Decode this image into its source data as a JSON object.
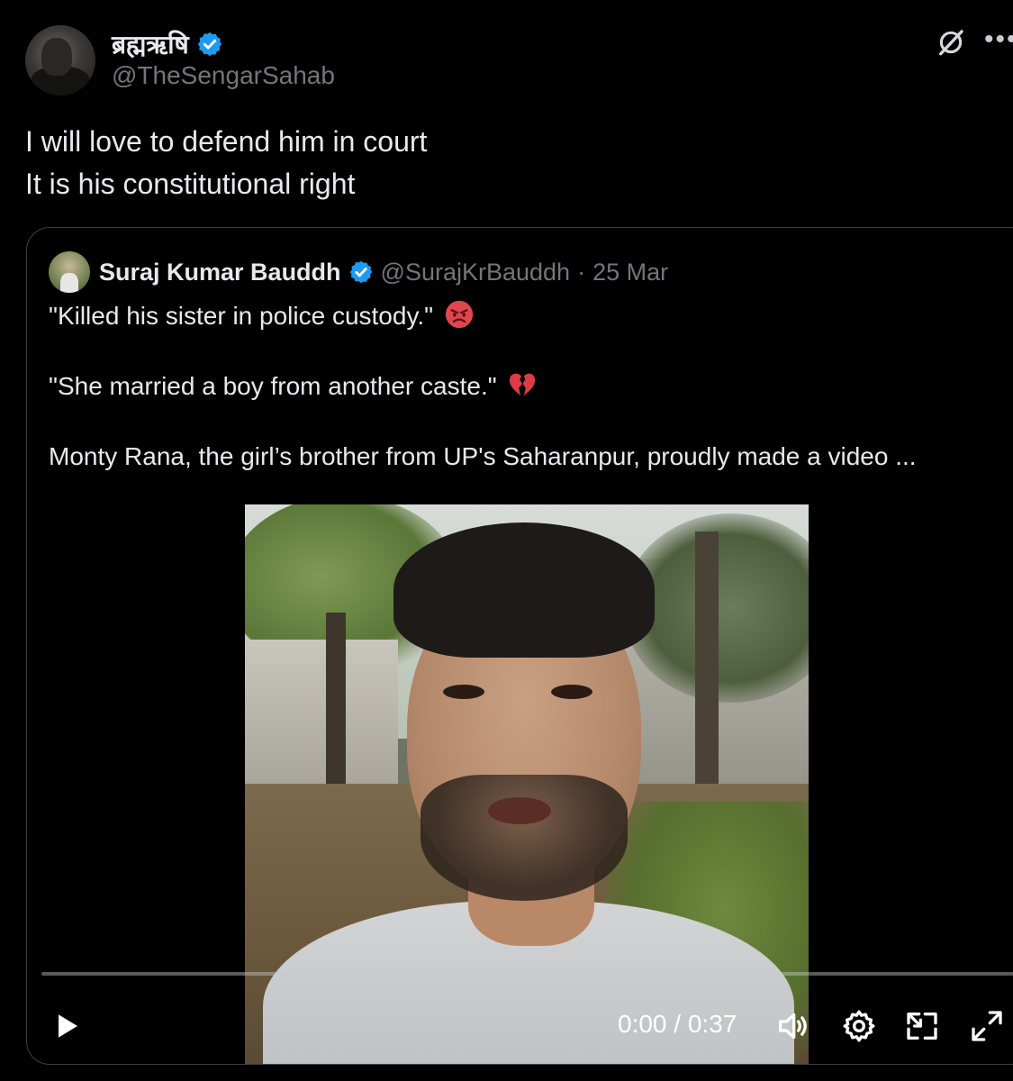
{
  "author": {
    "display_name": "ब्रह्मऋषि",
    "handle": "@TheSengarSahab",
    "verified": true
  },
  "tweet": {
    "lines": [
      "I will love to defend him in court",
      "It is his constitutional right"
    ]
  },
  "quoted_tweet": {
    "display_name": "Suraj Kumar Bauddh",
    "handle": "@SurajKrBauddh",
    "separator": "·",
    "date": "25 Mar",
    "lines": [
      "\"Killed his sister in police custody.\"",
      "\"She married a boy from another caste.\"",
      "Monty Rana, the girl’s brother from UP's Saharanpur, proudly made a video ..."
    ],
    "emojis": [
      "angry-face",
      "broken-heart"
    ]
  },
  "video_player": {
    "current_time": "0:00",
    "time_separator": " / ",
    "duration": "0:37",
    "time_display": "0:00 / 0:37",
    "progress": 0
  },
  "colors": {
    "background": "#000000",
    "text_primary": "#e7e9ea",
    "text_secondary": "#71767b",
    "verified_blue": "#1d9bf0",
    "border": "#3e4144",
    "emoji_red": "#e0474c"
  },
  "icons": {
    "verified": "verified-badge-icon",
    "grok": "grok-icon",
    "more": "more-icon",
    "play": "play-icon",
    "volume": "volume-icon",
    "settings": "settings-icon",
    "pip": "picture-in-picture-icon",
    "fullscreen": "fullscreen-icon"
  }
}
